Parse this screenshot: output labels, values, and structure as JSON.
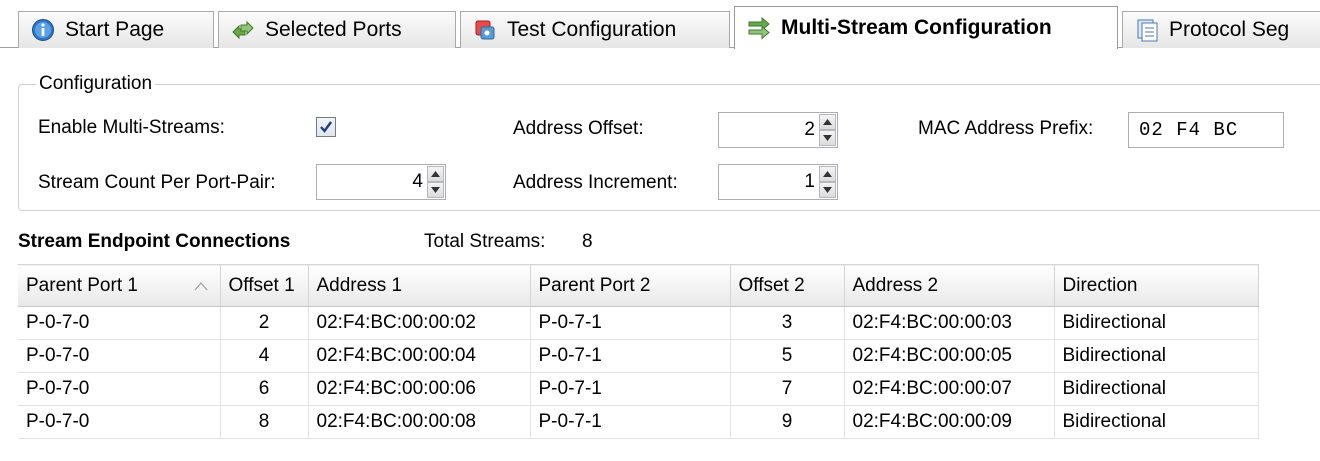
{
  "tabs": [
    {
      "label": "Start Page",
      "icon": "info-icon",
      "active": false
    },
    {
      "label": "Selected Ports",
      "icon": "ports-icon",
      "active": false
    },
    {
      "label": "Test Configuration",
      "icon": "config-icon",
      "active": false
    },
    {
      "label": "Multi-Stream Configuration",
      "icon": "multistream-icon",
      "active": true
    },
    {
      "label": "Protocol Seg",
      "icon": "protocol-icon",
      "active": false
    }
  ],
  "configuration": {
    "group_title": "Configuration",
    "enable_label": "Enable Multi-Streams:",
    "enable_checked": true,
    "stream_count_label": "Stream Count Per Port-Pair:",
    "stream_count_value": "4",
    "address_offset_label": "Address Offset:",
    "address_offset_value": "2",
    "address_increment_label": "Address Increment:",
    "address_increment_value": "1",
    "mac_prefix_label": "MAC Address Prefix:",
    "mac_prefix_value": "02 F4 BC"
  },
  "streams": {
    "title": "Stream Endpoint Connections",
    "total_label": "Total Streams:",
    "total_value": "8",
    "columns": [
      "Parent Port 1",
      "Offset 1",
      "Address 1",
      "Parent Port 2",
      "Offset 2",
      "Address 2",
      "Direction"
    ],
    "rows": [
      [
        "P-0-7-0",
        "2",
        "02:F4:BC:00:00:02",
        "P-0-7-1",
        "3",
        "02:F4:BC:00:00:03",
        "Bidirectional"
      ],
      [
        "P-0-7-0",
        "4",
        "02:F4:BC:00:00:04",
        "P-0-7-1",
        "5",
        "02:F4:BC:00:00:05",
        "Bidirectional"
      ],
      [
        "P-0-7-0",
        "6",
        "02:F4:BC:00:00:06",
        "P-0-7-1",
        "7",
        "02:F4:BC:00:00:07",
        "Bidirectional"
      ],
      [
        "P-0-7-0",
        "8",
        "02:F4:BC:00:00:08",
        "P-0-7-1",
        "9",
        "02:F4:BC:00:00:09",
        "Bidirectional"
      ]
    ]
  },
  "colors": {
    "accent": "#3c7fb1",
    "tab_border": "#a9a9a9",
    "grid_line": "#e2e2e2"
  }
}
